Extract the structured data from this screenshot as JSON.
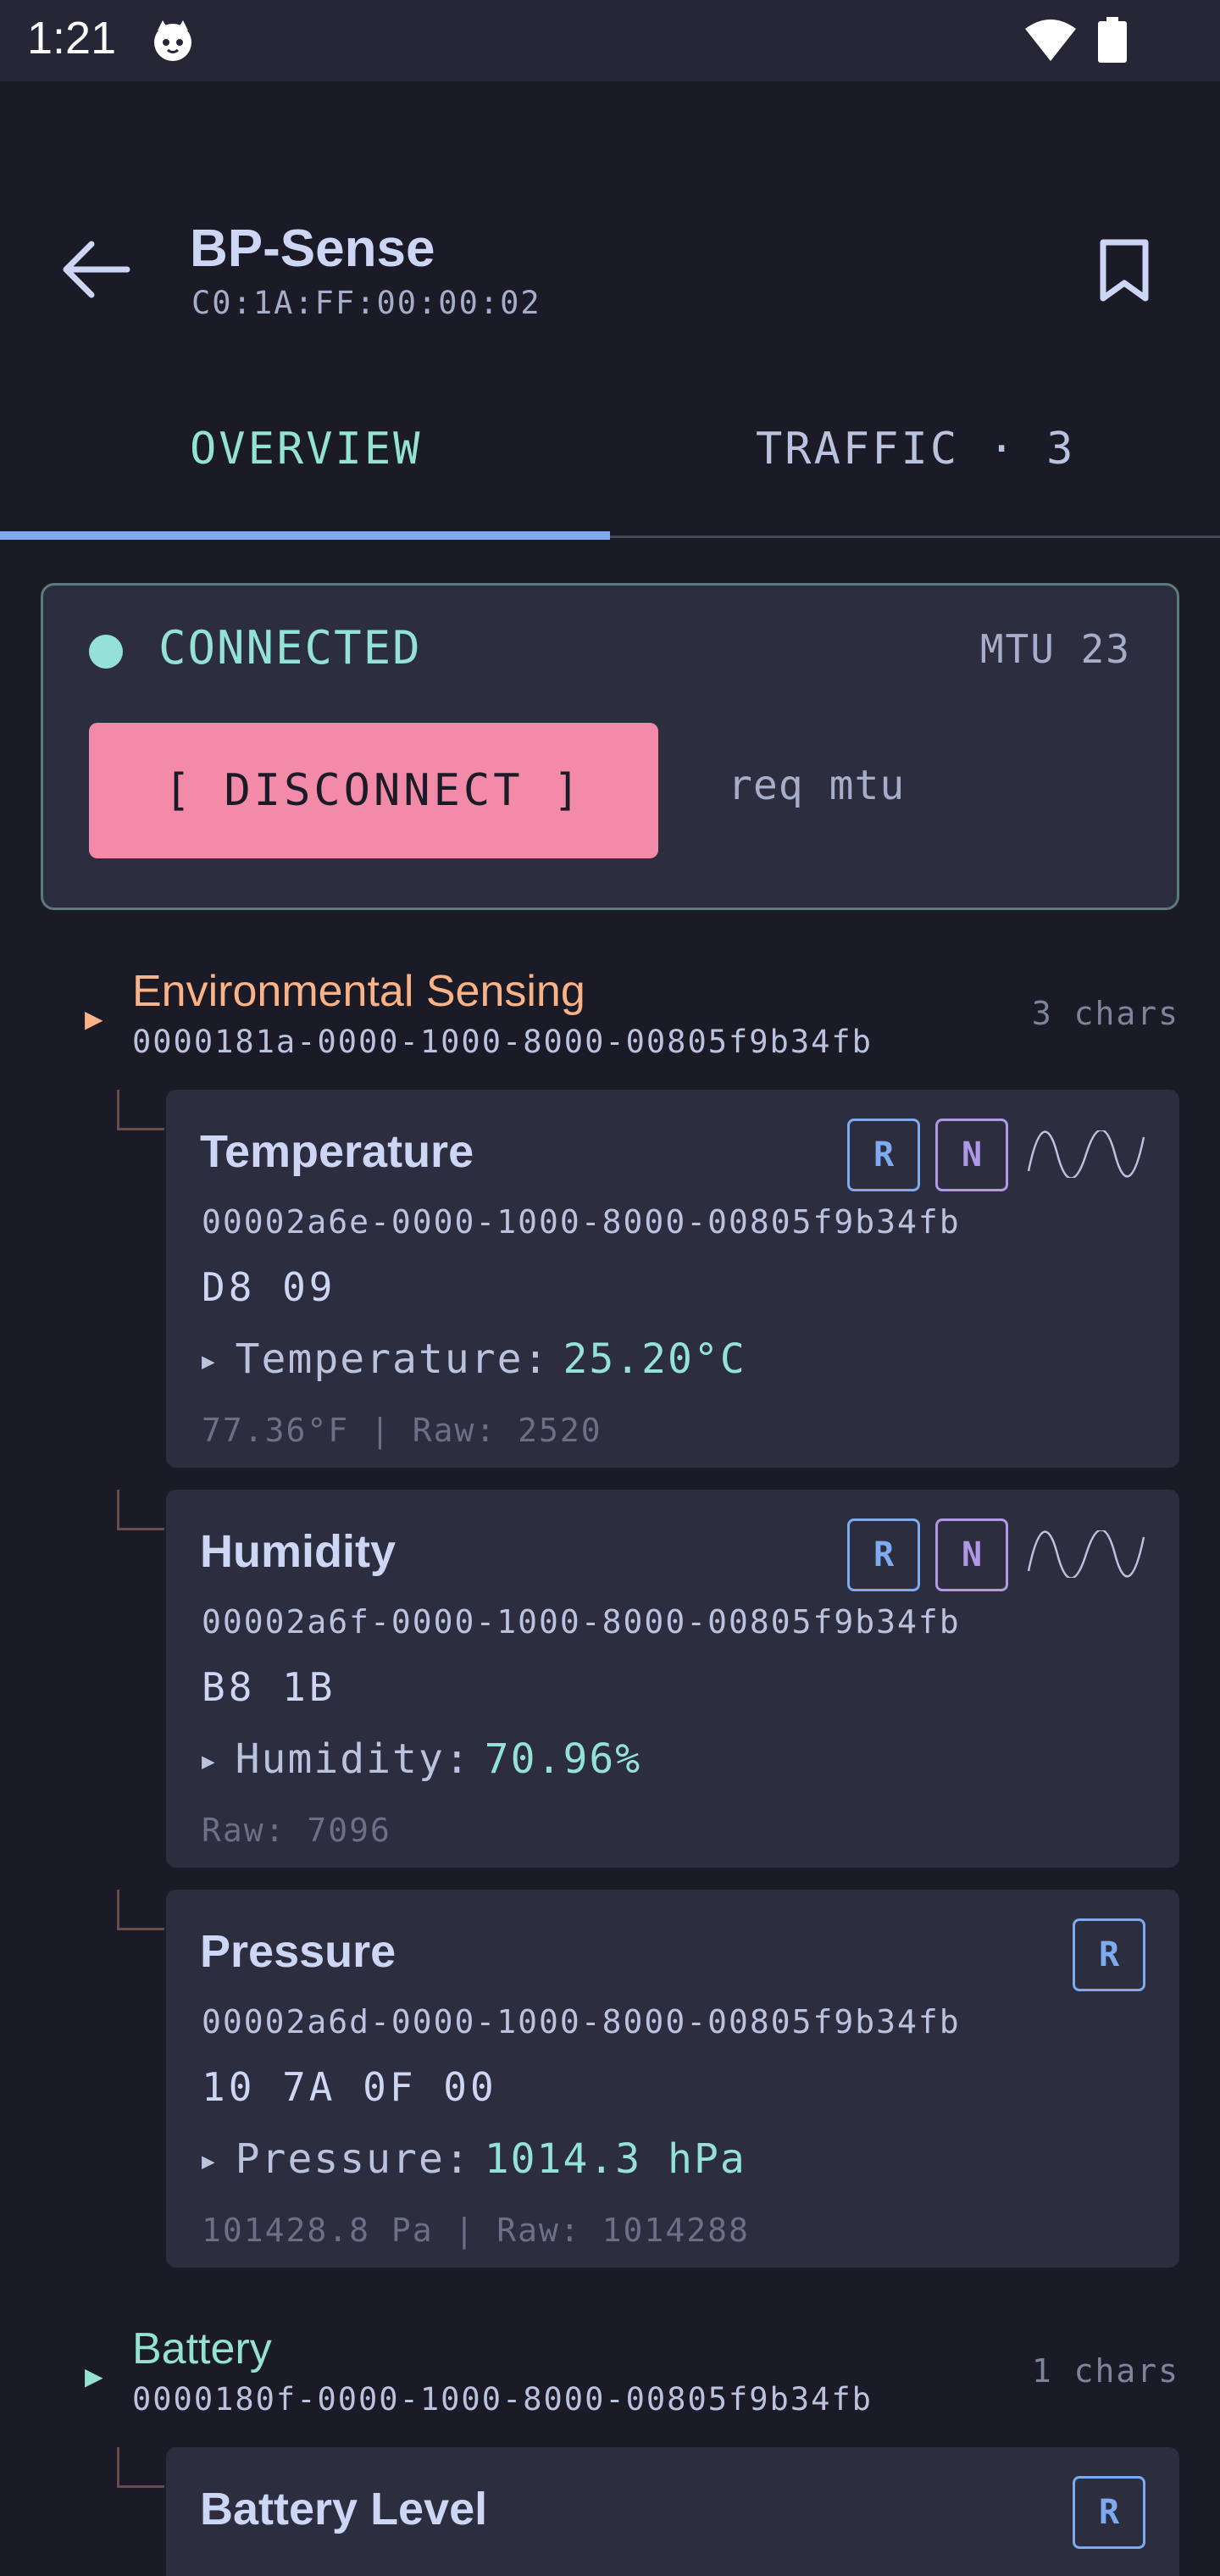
{
  "status_bar": {
    "time": "1:21"
  },
  "app_bar": {
    "title": "BP-Sense",
    "mac": "C0:1A:FF:00:00:02"
  },
  "tabs": [
    {
      "label": "OVERVIEW"
    },
    {
      "label": "TRAFFIC · 3"
    }
  ],
  "connection": {
    "status": "CONNECTED",
    "mtu": "MTU 23",
    "disconnect_label": "[ DISCONNECT ]",
    "req_mtu_label": "req mtu"
  },
  "services": [
    {
      "name": "Environmental Sensing",
      "uuid": "0000181a-0000-1000-8000-00805f9b34fb",
      "count": "3 chars",
      "color": "#fab387",
      "characteristics": [
        {
          "name": "Temperature",
          "uuid": "00002a6e-0000-1000-8000-00805f9b34fb",
          "hex": "D8 09",
          "field_label": "Temperature:",
          "field_value": "25.20°C",
          "sub": "77.36°F | Raw: 2520",
          "badges": [
            "R",
            "N"
          ]
        },
        {
          "name": "Humidity",
          "uuid": "00002a6f-0000-1000-8000-00805f9b34fb",
          "hex": "B8 1B",
          "field_label": "Humidity:",
          "field_value": "70.96%",
          "sub": "Raw: 7096",
          "badges": [
            "R",
            "N"
          ]
        },
        {
          "name": "Pressure",
          "uuid": "00002a6d-0000-1000-8000-00805f9b34fb",
          "hex": "10 7A 0F 00",
          "field_label": "Pressure:",
          "field_value": "1014.3 hPa",
          "sub": "101428.8 Pa | Raw: 1014288",
          "badges": [
            "R"
          ]
        }
      ]
    },
    {
      "name": "Battery",
      "uuid": "0000180f-0000-1000-8000-00805f9b34fb",
      "count": "1 chars",
      "color": "#94e2d5",
      "characteristics": [
        {
          "name": "Battery Level",
          "badges": [
            "R"
          ]
        }
      ]
    }
  ],
  "colors": {
    "background": "#1b1b28",
    "card": "#2c2d3f",
    "accent_teal": "#94e2d5",
    "accent_blue": "#7eaaf0",
    "accent_pink": "#f38ba8",
    "accent_orange": "#fab387",
    "accent_purple": "#b197e8"
  },
  "icons": {
    "status_notification": "cat-face-icon",
    "wifi": "wifi-icon",
    "battery": "battery-icon",
    "back": "arrow-back-icon",
    "bookmark": "bookmark-icon",
    "notify_wave": "wave-icon"
  }
}
